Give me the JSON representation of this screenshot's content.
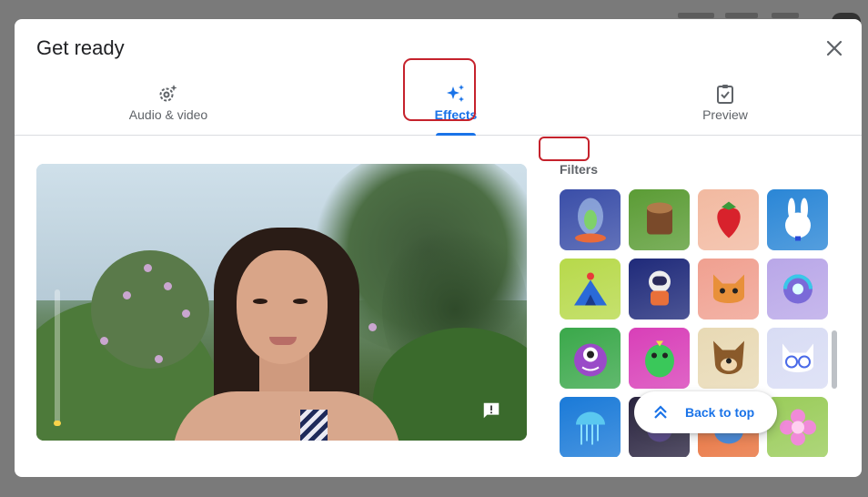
{
  "dialog": {
    "title": "Get ready"
  },
  "tabs": [
    {
      "label": "Audio & video",
      "icon": "audio-video-settings-icon",
      "active": false
    },
    {
      "label": "Effects",
      "icon": "sparkle-icon",
      "active": true
    },
    {
      "label": "Preview",
      "icon": "clipboard-check-icon",
      "active": false
    }
  ],
  "filters": {
    "heading": "Filters",
    "tiles": [
      {
        "name": "alien-in-jar",
        "icon": "alien-icon",
        "bg": "#3a4ea8"
      },
      {
        "name": "tree-stump",
        "icon": "stump-icon",
        "bg": "#5b9c35"
      },
      {
        "name": "strawberry",
        "icon": "strawberry-icon",
        "bg": "#f2b9a0"
      },
      {
        "name": "bunny",
        "icon": "bunny-icon",
        "bg": "#2a86d6"
      },
      {
        "name": "circus-tent",
        "icon": "tent-icon",
        "bg": "#b7d94a"
      },
      {
        "name": "astronaut",
        "icon": "astronaut-icon",
        "bg": "#1f2a7a"
      },
      {
        "name": "cat-face",
        "icon": "cat-icon",
        "bg": "#f0a090"
      },
      {
        "name": "headphones-character",
        "icon": "headphones-icon",
        "bg": "#b9a7e8"
      },
      {
        "name": "one-eyed-monster",
        "icon": "monster-icon",
        "bg": "#3aa84a"
      },
      {
        "name": "green-dino",
        "icon": "dino-icon",
        "bg": "#d83fb8"
      },
      {
        "name": "dog-face",
        "icon": "dog-icon",
        "bg": "#e8d9b4"
      },
      {
        "name": "cat-glasses",
        "icon": "cat-glasses-icon",
        "bg": "#d8dcf4"
      },
      {
        "name": "jellyfish",
        "icon": "jellyfish-icon",
        "bg": "#1a7ad8"
      },
      {
        "name": "space-cat",
        "icon": "space-icon",
        "bg": "#2a2440"
      },
      {
        "name": "blue-creature",
        "icon": "creature-icon",
        "bg": "#e8703a"
      },
      {
        "name": "flower",
        "icon": "flower-icon",
        "bg": "#9acc5a"
      }
    ]
  },
  "back_to_top": {
    "label": "Back to top"
  },
  "colors": {
    "accent": "#1a73e8",
    "highlight": "#c5222c"
  }
}
